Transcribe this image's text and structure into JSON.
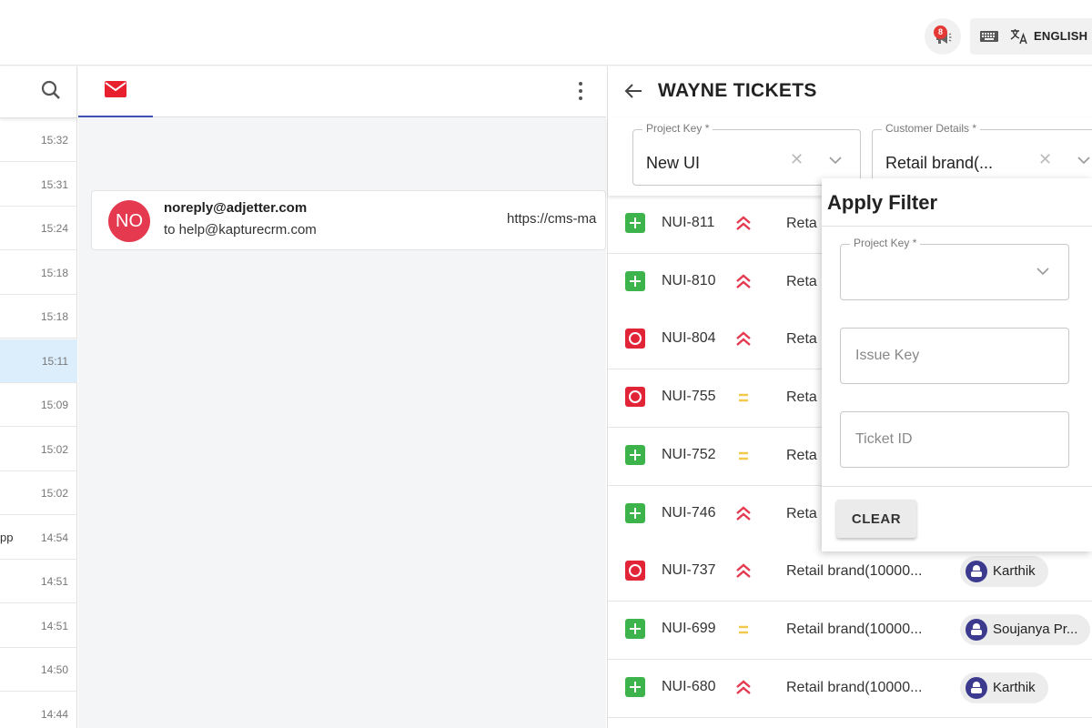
{
  "topbar": {
    "notification_count": "8",
    "language": "ENGLISH",
    "icons": [
      "announcement-icon",
      "keyboard-icon",
      "translate-icon"
    ]
  },
  "left_list": {
    "search_icon": "search-icon",
    "rows": [
      {
        "snippet": "",
        "time": "15:32",
        "active": false
      },
      {
        "snippet": "",
        "time": "15:31",
        "active": false
      },
      {
        "snippet": "",
        "time": "15:24",
        "active": false
      },
      {
        "snippet": "",
        "time": "15:18",
        "active": false
      },
      {
        "snippet": "",
        "time": "15:18",
        "active": false
      },
      {
        "snippet": "",
        "time": "15:11",
        "active": true
      },
      {
        "snippet": "",
        "time": "15:09",
        "active": false
      },
      {
        "snippet": "",
        "time": "15:02",
        "active": false
      },
      {
        "snippet": "",
        "time": "15:02",
        "active": false
      },
      {
        "snippet": "pp",
        "time": "14:54",
        "active": false
      },
      {
        "snippet": "",
        "time": "14:51",
        "active": false
      },
      {
        "snippet": "",
        "time": "14:51",
        "active": false
      },
      {
        "snippet": "",
        "time": "14:50",
        "active": false
      },
      {
        "snippet": "",
        "time": "14:44",
        "active": false
      }
    ]
  },
  "mail": {
    "avatar_initials": "NO",
    "from": "noreply@adjetter.com",
    "to": "to help@kapturecrm.com",
    "link_preview": "https://cms-ma"
  },
  "tickets_panel": {
    "title": "WAYNE TICKETS",
    "filters": {
      "project_key_label": "Project Key *",
      "project_key_value": "New UI",
      "customer_label": "Customer Details *",
      "customer_value": "Retail brand(..."
    },
    "rows": [
      {
        "type": "plus",
        "key": "NUI-811",
        "priority": "high",
        "desc": "Reta",
        "assignee": ""
      },
      {
        "type": "plus",
        "key": "NUI-810",
        "priority": "high",
        "desc": "Reta",
        "assignee": ""
      },
      {
        "type": "stop",
        "key": "NUI-804",
        "priority": "high",
        "desc": "Reta",
        "assignee": ""
      },
      {
        "type": "stop",
        "key": "NUI-755",
        "priority": "medium",
        "desc": "Reta",
        "assignee": ""
      },
      {
        "type": "plus",
        "key": "NUI-752",
        "priority": "medium",
        "desc": "Reta",
        "assignee": ""
      },
      {
        "type": "plus",
        "key": "NUI-746",
        "priority": "high",
        "desc": "Reta",
        "assignee": ""
      },
      {
        "type": "stop",
        "key": "NUI-737",
        "priority": "high",
        "desc": "Retail brand(10000...",
        "assignee": "Karthik"
      },
      {
        "type": "plus",
        "key": "NUI-699",
        "priority": "medium",
        "desc": "Retail brand(10000...",
        "assignee": "Soujanya Pr..."
      },
      {
        "type": "plus",
        "key": "NUI-680",
        "priority": "high",
        "desc": "Retail brand(10000...",
        "assignee": "Karthik"
      }
    ]
  },
  "apply_filter": {
    "title": "Apply Filter",
    "project_key_label": "Project Key *",
    "issue_key_placeholder": "Issue Key",
    "ticket_id_placeholder": "Ticket ID",
    "clear_label": "CLEAR"
  },
  "colors": {
    "accent": "#3f51b5",
    "mail_red": "#e8202e",
    "priority_high": "#e53950",
    "priority_medium": "#f2c94c",
    "ticket_new": "#3cb44b",
    "ticket_bug": "#e22437",
    "active_row": "#dceefb"
  }
}
